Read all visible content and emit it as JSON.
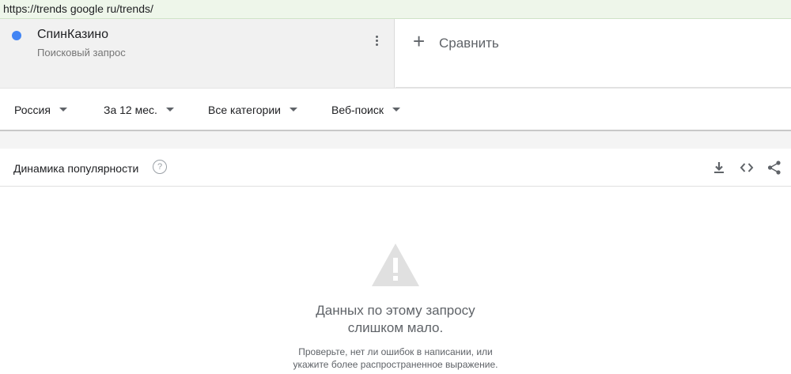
{
  "browser": {
    "url": "https://trends google ru/trends/"
  },
  "term": {
    "name": "СпинКазино",
    "subtitle": "Поисковый запрос",
    "color": "#4285f4"
  },
  "compare": {
    "label": "Сравнить"
  },
  "filters": [
    {
      "label": "Россия"
    },
    {
      "label": "За 12 мес."
    },
    {
      "label": "Все категории"
    },
    {
      "label": "Веб-поиск"
    }
  ],
  "panel": {
    "title": "Динамика популярности",
    "help": "?",
    "tools": [
      "download-icon",
      "embed-code-icon",
      "share-icon"
    ]
  },
  "empty_state": {
    "line1": "Данных по этому запросу",
    "line2": "слишком мало.",
    "hint1": "Проверьте, нет ли ошибок в написании, или",
    "hint2": "укажите более распространенное выражение."
  }
}
